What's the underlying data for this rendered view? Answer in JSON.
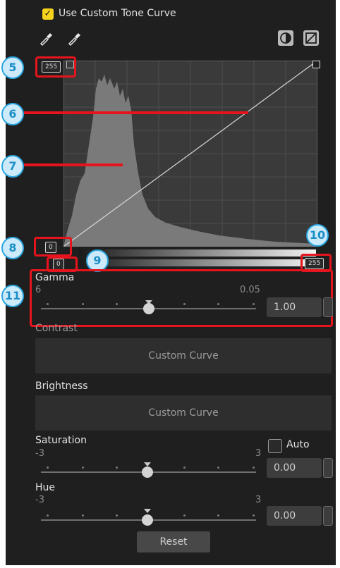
{
  "header": {
    "use_custom_label": "Use Custom Tone Curve",
    "checkmark": "✓"
  },
  "curve": {
    "top_label": "255"
  },
  "input_tags": {
    "black": "0",
    "white": "255",
    "black_out": "0"
  },
  "gamma": {
    "label": "Gamma",
    "min": "6",
    "max": "0.05",
    "value": "1.00"
  },
  "contrast": {
    "label": "Contrast",
    "value": "Custom Curve"
  },
  "brightness": {
    "label": "Brightness",
    "value": "Custom Curve"
  },
  "saturation": {
    "label": "Saturation",
    "min": "-3",
    "max": "3",
    "value": "0.00",
    "auto_label": "Auto"
  },
  "hue": {
    "label": "Hue",
    "min": "-3",
    "max": "3",
    "value": "0.00"
  },
  "reset": {
    "label": "Reset"
  },
  "callouts": [
    "5",
    "6",
    "7",
    "8",
    "9",
    "10",
    "11"
  ],
  "colors": {
    "panel": "#1f1f1f",
    "accent_check": "#f5d21c",
    "callout_red": "#e6141c",
    "callout_blue": "#2aa6e0"
  }
}
